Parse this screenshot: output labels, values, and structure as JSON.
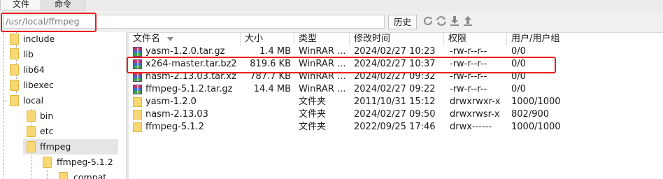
{
  "tabs": [
    "文件",
    "命令"
  ],
  "path": {
    "value": "/usr/local/ffmpeg"
  },
  "toolbar": {
    "history_label": "历史",
    "icons": [
      "refresh-icon",
      "sync-icon",
      "download-icon",
      "upload-icon"
    ]
  },
  "tree": {
    "items": [
      {
        "label": "include"
      },
      {
        "label": "lib"
      },
      {
        "label": "lib64"
      },
      {
        "label": "libexec"
      },
      {
        "label": "local"
      },
      {
        "label": "bin"
      },
      {
        "label": "etc"
      },
      {
        "label": "ffmpeg",
        "selected": true
      },
      {
        "label": "ffmpeg-5.1.2"
      },
      {
        "label": "compat"
      }
    ]
  },
  "columns": {
    "name": "文件名",
    "size": "大小",
    "type": "类型",
    "mtime": "修改时间",
    "perm": "权限",
    "owner": "用户/用户组"
  },
  "files": [
    {
      "name": "yasm-1.2.0.tar.gz",
      "size": "1.4 MB",
      "type": "WinRAR ...",
      "mtime": "2024/02/27 10:23",
      "perm": "-rw-r--r--",
      "owner": "0/0",
      "icon": "rar-archive-icon"
    },
    {
      "name": "x264-master.tar.bz2",
      "size": "819.6 KB",
      "type": "WinRAR ...",
      "mtime": "2024/02/27 10:37",
      "perm": "-rw-r--r--",
      "owner": "0/0",
      "icon": "rar-archive-icon",
      "highlighted": true
    },
    {
      "name": "nasm-2.13.03.tar.xz",
      "size": "787.7 KB",
      "type": "WinRAR ...",
      "mtime": "2024/02/27 09:32",
      "perm": "-rw-r--r--",
      "owner": "0/0",
      "icon": "rar-archive-icon"
    },
    {
      "name": "ffmpeg-5.1.2.tar.gz",
      "size": "14.4 MB",
      "type": "WinRAR ...",
      "mtime": "2024/02/27 09:22",
      "perm": "-rw-r--r--",
      "owner": "0/0",
      "icon": "rar-archive-icon"
    },
    {
      "name": "yasm-1.2.0",
      "size": "",
      "type": "文件夹",
      "mtime": "2011/10/31 15:12",
      "perm": "drwxrwxr-x",
      "owner": "1000/1000",
      "icon": "folder-icon"
    },
    {
      "name": "nasm-2.13.03",
      "size": "",
      "type": "文件夹",
      "mtime": "2024/02/27 09:50",
      "perm": "drwxrwsr-x",
      "owner": "802/900",
      "icon": "folder-icon"
    },
    {
      "name": "ffmpeg-5.1.2",
      "size": "",
      "type": "文件夹",
      "mtime": "2022/09/25 17:46",
      "perm": "drwx------",
      "owner": "1000/1000",
      "icon": "folder-icon"
    }
  ]
}
